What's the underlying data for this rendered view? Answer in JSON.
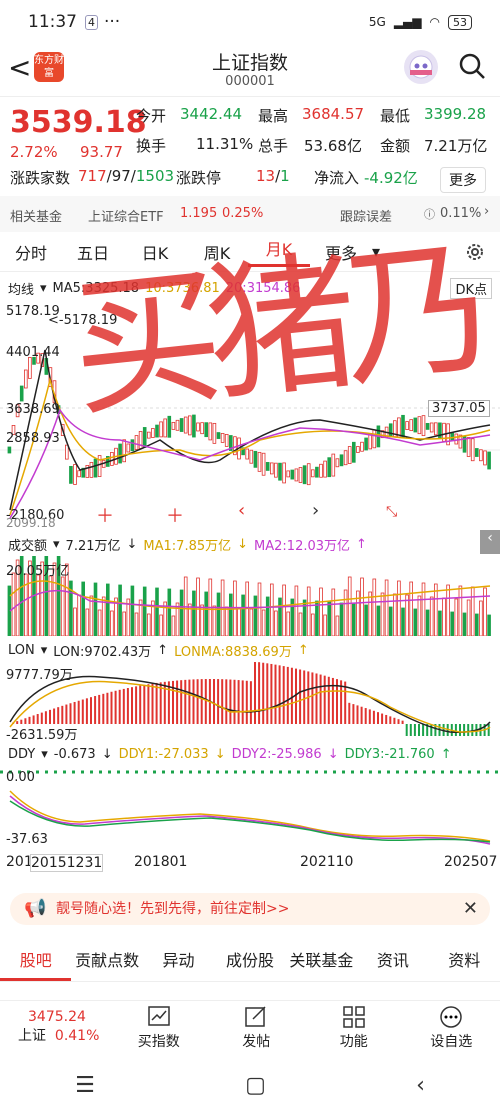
{
  "status": {
    "time": "11:37",
    "notif": "4",
    "dots": "···",
    "network": "5G",
    "battery": "53"
  },
  "header": {
    "back": "<",
    "logo": "东方财富",
    "title": "上证指数",
    "code": "000001"
  },
  "quote": {
    "price": "3539.18",
    "pct": "2.72%",
    "change": "93.77",
    "items": [
      {
        "label": "今开",
        "value": "3442.44",
        "color": "green"
      },
      {
        "label": "最高",
        "value": "3684.57",
        "color": "red"
      },
      {
        "label": "最低",
        "value": "3399.28",
        "color": "green"
      },
      {
        "label": "换手",
        "value": "11.31%",
        "color": "black"
      },
      {
        "label": "总手",
        "value": "53.68亿",
        "color": "black"
      },
      {
        "label": "金额",
        "value": "7.21万亿",
        "color": "black"
      }
    ],
    "updown_label": "涨跌家数",
    "up": "717",
    "flat": "97",
    "down": "1503",
    "limit_label": "涨跌停",
    "limit_up": "13",
    "limit_down": "1",
    "netflow_label": "净流入",
    "netflow": "-4.92亿",
    "more": "更多"
  },
  "fund": {
    "label": "相关基金",
    "name": "上证综合ETF",
    "v1": "1.195",
    "v2": "0.25%",
    "track_label": "跟踪误差",
    "track": "0.11%"
  },
  "tabs": [
    "分时",
    "五日",
    "日K",
    "周K",
    "月K",
    "更多"
  ],
  "kline": {
    "type_label": "均线",
    "ma5": "MA5:3325.18",
    "ma10": "10:3736.81",
    "ma20": "20:3154.86",
    "dk": "DK点",
    "high_mark": "5178.19",
    "high_arrow": "<-5178.19",
    "y1": "4401.44",
    "y2": "3638.69",
    "y3": "2858.93",
    "low_mark": "-2180.60",
    "low_y": "2099.18",
    "cur_price": "3737.05"
  },
  "volume": {
    "label": "成交额",
    "value": "7.21万亿",
    "ma1": "MA1:7.85万亿",
    "ma2": "MA2:12.03万亿",
    "ytop": "20.05万亿"
  },
  "lon": {
    "label": "LON",
    "value": "LON:9702.43万",
    "ma": "LONMA:8838.69万",
    "ytop": "9777.79万",
    "ybot": "-2631.59万"
  },
  "ddy": {
    "label": "DDY",
    "value": "-0.673",
    "d1": "DDY1:-27.033",
    "d2": "DDY2:-25.986",
    "d3": "DDY3:-21.760",
    "ytop": "0.00",
    "ybot": "-37.63"
  },
  "xaxis": [
    "201",
    "20151231",
    "201801",
    "202110",
    "202507"
  ],
  "handwriting": "买猪乃",
  "banner": {
    "text": "靓号随心选！先到先得，前往定制>>"
  },
  "bottom_tabs": [
    "股吧",
    "贡献点数",
    "异动",
    "成份股",
    "关联基金",
    "资讯",
    "资料"
  ],
  "footer": {
    "index_price": "3475.24",
    "index_name": "上证",
    "index_pct": "0.41%",
    "items": [
      "买指数",
      "发帖",
      "功能",
      "设自选"
    ]
  },
  "colors": {
    "red": "#e0332f",
    "green": "#1aa24a"
  }
}
